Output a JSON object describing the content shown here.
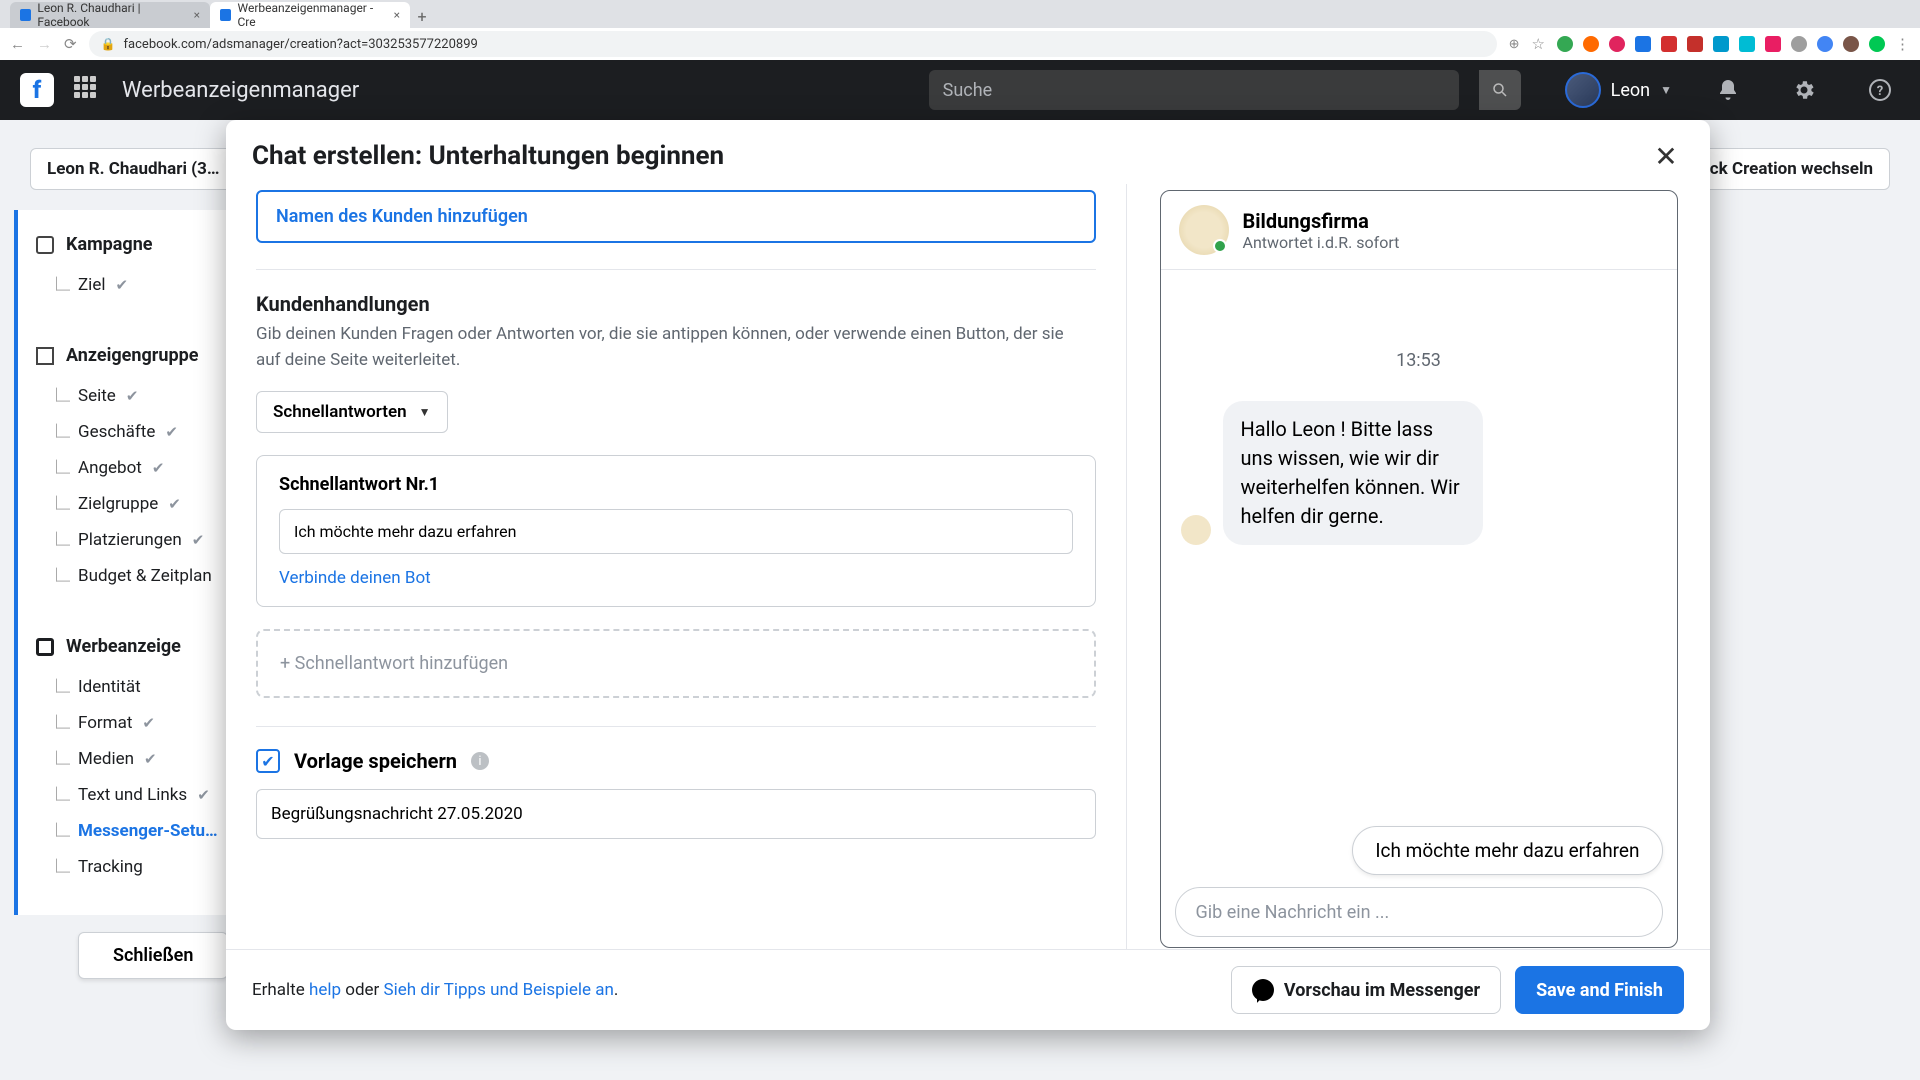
{
  "browser": {
    "tabs": [
      {
        "title": "Leon R. Chaudhari | Facebook",
        "active": false
      },
      {
        "title": "Werbeanzeigenmanager - Cre",
        "active": true
      }
    ],
    "url": "facebook.com/adsmanager/creation?act=303253577220899"
  },
  "fb_header": {
    "app_title": "Werbeanzeigenmanager",
    "search_placeholder": "Suche",
    "user_name": "Leon"
  },
  "background": {
    "account_label": "Leon R. Chaudhari (3…",
    "switch_label": "…ck Creation wechseln",
    "nav": {
      "campaign": {
        "title": "Kampagne",
        "items": [
          "Ziel"
        ]
      },
      "adset": {
        "title": "Anzeigengruppe",
        "items": [
          "Seite",
          "Geschäfte",
          "Angebot",
          "Zielgruppe",
          "Platzierungen",
          "Budget & Zeitplan"
        ]
      },
      "ad": {
        "title": "Werbeanzeige",
        "items": [
          "Identität",
          "Format",
          "Medien",
          "Text und Links",
          "Messenger-Setu…",
          "Tracking"
        ],
        "current": "Messenger-Setu…"
      }
    },
    "close_btn": "Schließen"
  },
  "modal": {
    "title": "Chat erstellen: Unterhaltungen beginnen",
    "add_customer_name": "Namen des Kunden hinzufügen",
    "actions_title": "Kundenhandlungen",
    "actions_desc": "Gib deinen Kunden Fragen oder Antworten vor, die sie antippen können, oder verwende einen Button, der sie auf deine Seite weiterleitet.",
    "dropdown_label": "Schnellantworten",
    "quick_reply": {
      "heading": "Schnellantwort Nr.1",
      "value": "Ich möchte mehr dazu erfahren",
      "bot_link": "Verbinde deinen Bot"
    },
    "add_quick_reply": "+ Schnellantwort hinzufügen",
    "save_template_label": "Vorlage speichern",
    "template_name": "Begrüßungsnachricht 27.05.2020",
    "footer": {
      "prefix": "Erhalte ",
      "help": "help",
      "mid": " oder ",
      "tips": "Sieh dir Tipps und Beispiele an",
      "suffix": ".",
      "preview_btn": "Vorschau im Messenger",
      "save_btn": "Save and Finish"
    }
  },
  "preview": {
    "brand": "Bildungsfirma",
    "brand_sub": "Antwortet i.d.R. sofort",
    "timestamp": "13:53",
    "message": "Hallo Leon ! Bitte lass uns wissen, wie wir dir weiterhelfen können. Wir helfen dir gerne.",
    "quick_reply": "Ich möchte mehr dazu erfahren",
    "compose_placeholder": "Gib eine Nachricht ein ..."
  },
  "colors": {
    "primary": "#1b74e4",
    "fb_dark": "#1c1e21"
  }
}
